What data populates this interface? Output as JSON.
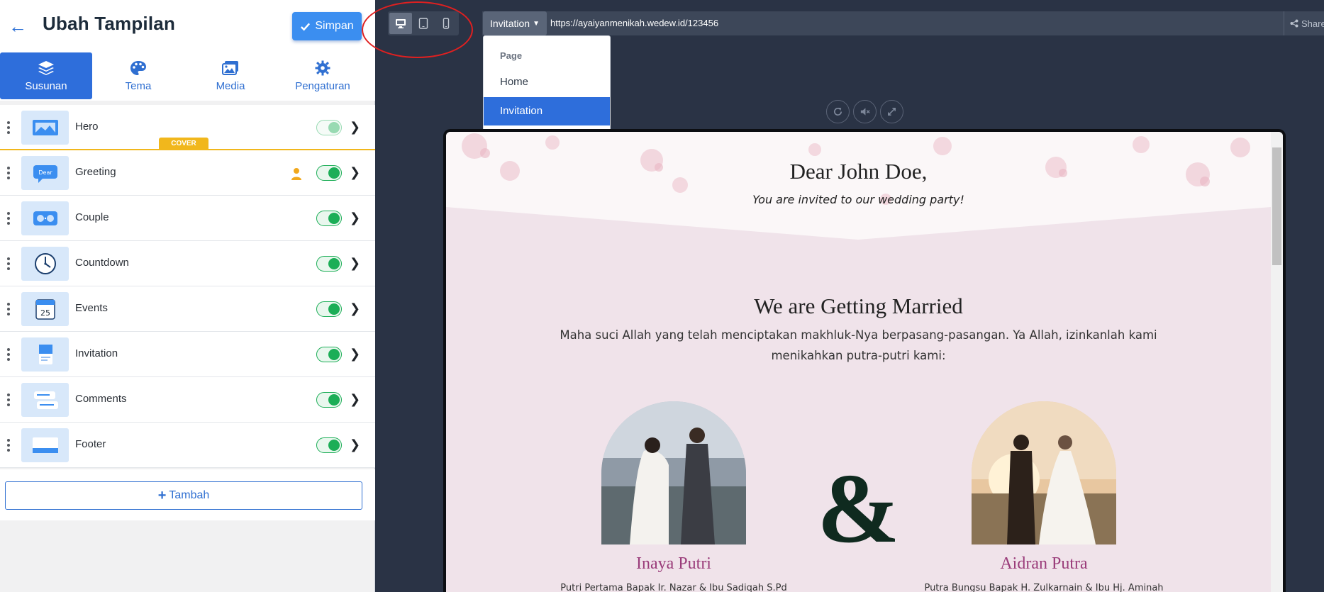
{
  "editor": {
    "title": "Ubah Tampilan",
    "save_label": "Simpan",
    "add_label": "Tambah",
    "tabs": [
      {
        "label": "Susunan",
        "icon": "layers-icon"
      },
      {
        "label": "Tema",
        "icon": "palette-icon"
      },
      {
        "label": "Media",
        "icon": "image-icon"
      },
      {
        "label": "Pengaturan",
        "icon": "gear-icon"
      }
    ],
    "cover_badge": "COVER",
    "sections": [
      {
        "label": "Hero",
        "enabled": true
      },
      {
        "label": "Greeting",
        "enabled": true
      },
      {
        "label": "Couple",
        "enabled": true
      },
      {
        "label": "Countdown",
        "enabled": true
      },
      {
        "label": "Events",
        "enabled": true,
        "thumb_text": "25"
      },
      {
        "label": "Invitation",
        "enabled": true
      },
      {
        "label": "Comments",
        "enabled": true
      },
      {
        "label": "Footer",
        "enabled": true
      }
    ],
    "greeting_thumb_text": "Dear",
    "accent_color": "#2e6edb",
    "toggle_color": "#1cae57",
    "cover_color": "#f1b71c"
  },
  "toolbar": {
    "devices": [
      "desktop-icon",
      "tablet-icon",
      "mobile-icon"
    ],
    "selected_page": "Invitation",
    "url": "https://ayaiyanmenikah.wedew.id/123456",
    "share_label": "Share",
    "dropdown": {
      "header": "Page",
      "items": [
        "Home",
        "Invitation"
      ],
      "selected": "Invitation"
    }
  },
  "preview": {
    "greeting": "Dear John Doe,",
    "invited": "You are invited to our wedding party!",
    "heading": "We are Getting Married",
    "verse": "Maha suci Allah yang telah menciptakan makhluk-Nya berpasang-pasangan. Ya Allah, izinkanlah kami menikahkan putra-putri kami:",
    "ampersand": "&",
    "bride": {
      "name": "Inaya Putri",
      "parents": "Putri Pertama Bapak Ir. Nazar & Ibu Sadiqah S.Pd"
    },
    "groom": {
      "name": "Aidran Putra",
      "parents": "Putra Bungsu Bapak H. Zulkarnain & Ibu Hj. Aminah"
    }
  }
}
